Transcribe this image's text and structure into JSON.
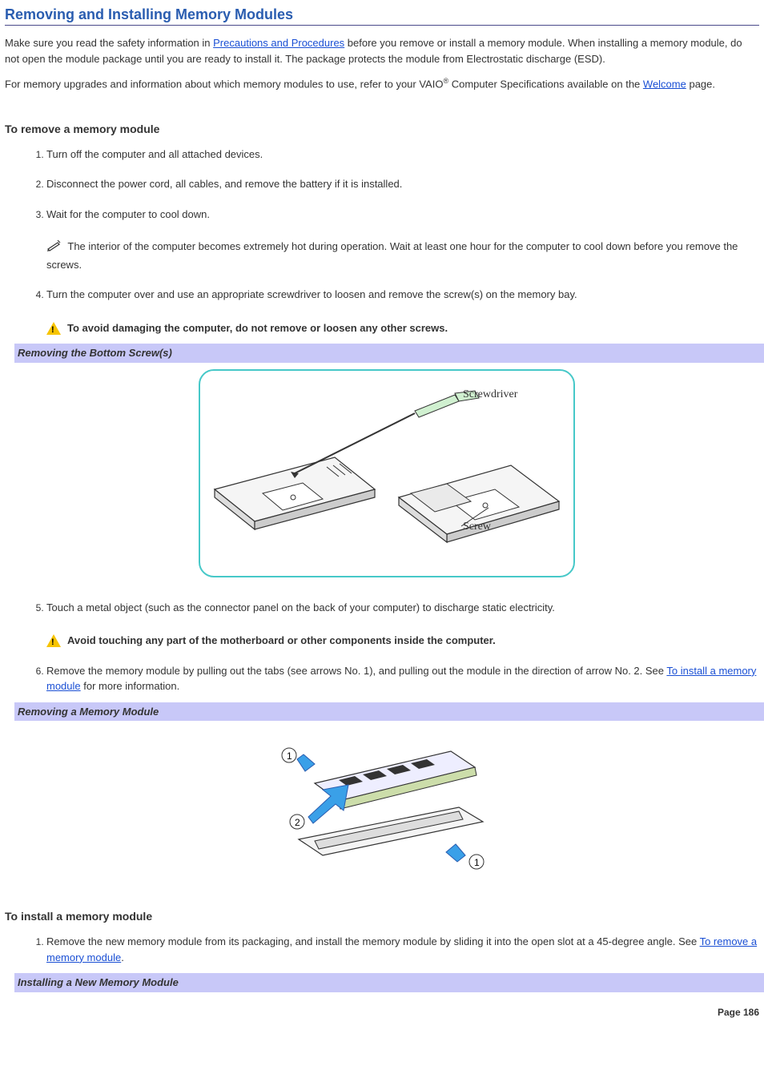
{
  "title": "Removing and Installing Memory Modules",
  "intro_para1_a": "Make sure you read the safety information in ",
  "intro_link1": "Precautions and Procedures",
  "intro_para1_b": " before you remove or install a memory module. When installing a memory module, do not open the module package until you are ready to install it. The package protects the module from Electrostatic discharge (ESD).",
  "intro_para2_a": "For memory upgrades and information about which memory modules to use, refer to your VAIO",
  "intro_para2_b": " Computer Specifications available on the ",
  "intro_link2": "Welcome",
  "intro_para2_c": " page.",
  "remove_heading": "To remove a memory module",
  "remove_steps": {
    "s1": "Turn off the computer and all attached devices.",
    "s2": "Disconnect the power cord, all cables, and remove the battery if it is installed.",
    "s3": "Wait for the computer to cool down.",
    "s3_note": " The interior of the computer becomes extremely hot during operation. Wait at least one hour for the computer to cool down before you remove the screws.",
    "s4": "Turn the computer over and use an appropriate screwdriver to loosen and remove the screw(s) on the memory bay.",
    "s4_caution": " To avoid damaging the computer, do not remove or loosen any other screws.",
    "s5": "Touch a metal object (such as the connector panel on the back of your computer) to discharge static electricity.",
    "s5_caution": " Avoid touching any part of the motherboard or other components inside the computer.",
    "s6_a": "Remove the memory module by pulling out the tabs (see arrows No. 1), and pulling out the module in the direction of arrow No. 2. See ",
    "s6_link": "To install a memory module",
    "s6_b": " for more information."
  },
  "figure1_caption": "Removing the Bottom Screw(s)",
  "figure1_label_screwdriver": "Screwdriver",
  "figure1_label_screw": "Screw",
  "figure2_caption": "Removing a Memory Module",
  "install_heading": "To install a memory module",
  "install_steps": {
    "s1_a": "Remove the new memory module from its packaging, and install the memory module by sliding it into the open slot at a 45-degree angle. See ",
    "s1_link": "To remove a memory module",
    "s1_b": "."
  },
  "figure3_caption": "Installing a New Memory Module",
  "page_number": "Page 186"
}
